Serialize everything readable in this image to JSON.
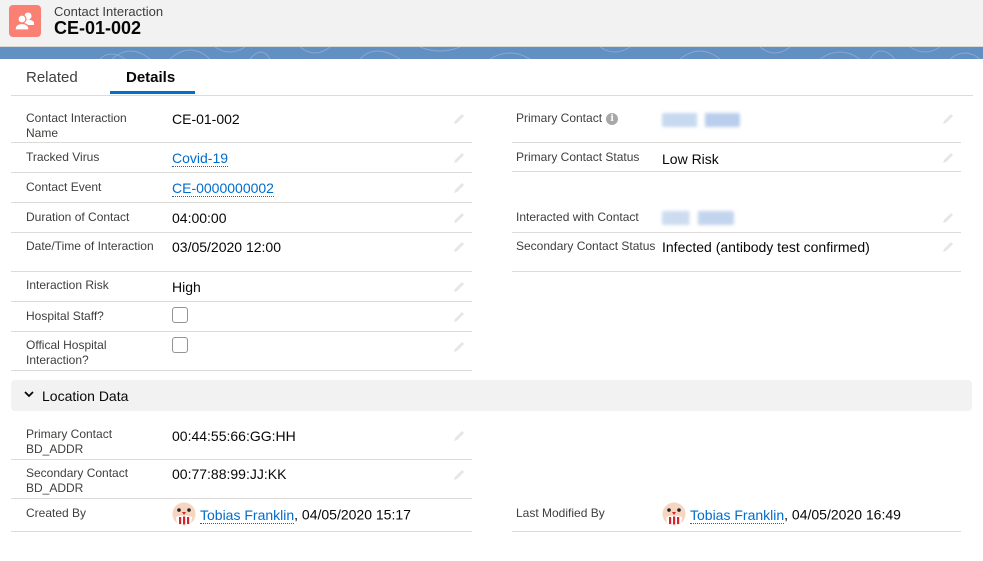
{
  "header": {
    "object_icon": "contacts-icon",
    "object_label": "Contact Interaction",
    "record_title": "CE-01-002",
    "icon_color": "#fa8073"
  },
  "tabs": [
    {
      "label": "Related",
      "active": false
    },
    {
      "label": "Details",
      "active": true
    }
  ],
  "accent_color": "#0070d2",
  "details": {
    "left": [
      {
        "label": "Contact Interaction Name",
        "value": "CE-01-002",
        "type": "text"
      },
      {
        "label": "Tracked Virus",
        "value": "Covid-19",
        "type": "link"
      },
      {
        "label": "Contact Event",
        "value": "CE-0000000002",
        "type": "link"
      },
      {
        "label": "Duration of Contact",
        "value": "04:00:00",
        "type": "text"
      },
      {
        "label": "Date/Time of Interaction",
        "value": "03/05/2020 12:00",
        "type": "text"
      },
      {
        "label": "Interaction Risk",
        "value": "High",
        "type": "text"
      },
      {
        "label": "Hospital Staff?",
        "value": false,
        "type": "checkbox"
      },
      {
        "label": "Offical Hospital Interaction?",
        "value": false,
        "type": "checkbox"
      }
    ],
    "right": [
      {
        "label": "Primary Contact",
        "value": "[blurred]",
        "type": "blurred-link",
        "info_icon": true
      },
      {
        "label": "Primary Contact Status",
        "value": "Low Risk",
        "type": "text"
      },
      {
        "label": "Interacted with Contact",
        "value": "[blurred]",
        "type": "blurred-link"
      },
      {
        "label": "Secondary Contact Status",
        "value": "Infected (antibody test confirmed)",
        "type": "text"
      }
    ]
  },
  "location_section": {
    "title": "Location Data",
    "expanded": true,
    "fields": [
      {
        "label": "Primary Contact BD_ADDR",
        "value": "00:44:55:66:GG:HH"
      },
      {
        "label": "Secondary Contact BD_ADDR",
        "value": "00:77:88:99:JJ:KK"
      }
    ]
  },
  "system": {
    "created_by": {
      "label": "Created By",
      "user": "Tobias Franklin",
      "timestamp": ", 04/05/2020 15:17"
    },
    "last_modified_by": {
      "label": "Last Modified By",
      "user": "Tobias Franklin",
      "timestamp": ", 04/05/2020 16:49"
    }
  }
}
